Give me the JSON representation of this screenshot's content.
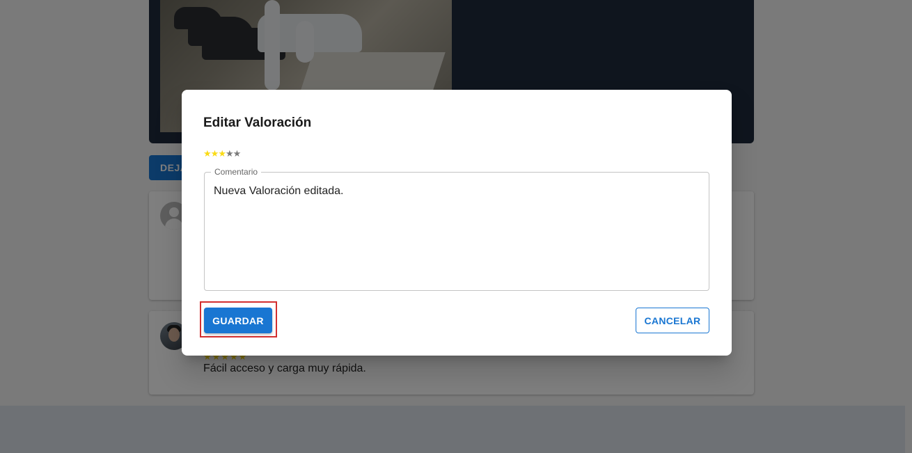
{
  "background": {
    "leave_review_button": "DEJA",
    "reviews": [
      {
        "stars": "",
        "comment": ""
      },
      {
        "stars": "★★★★★",
        "comment": "Fácil acceso y carga muy rápida."
      }
    ]
  },
  "dialog": {
    "title": "Editar Valoración",
    "rating": {
      "value": 3,
      "max": 5
    },
    "comment_label": "Comentario",
    "comment_value": "Nueva Valoración editada.",
    "save_label": "GUARDAR",
    "cancel_label": "CANCELAR"
  },
  "colors": {
    "primary": "#1976d2",
    "star_filled": "#fadb14",
    "star_empty": "#7a7a7a",
    "highlight": "#d32f2f"
  }
}
